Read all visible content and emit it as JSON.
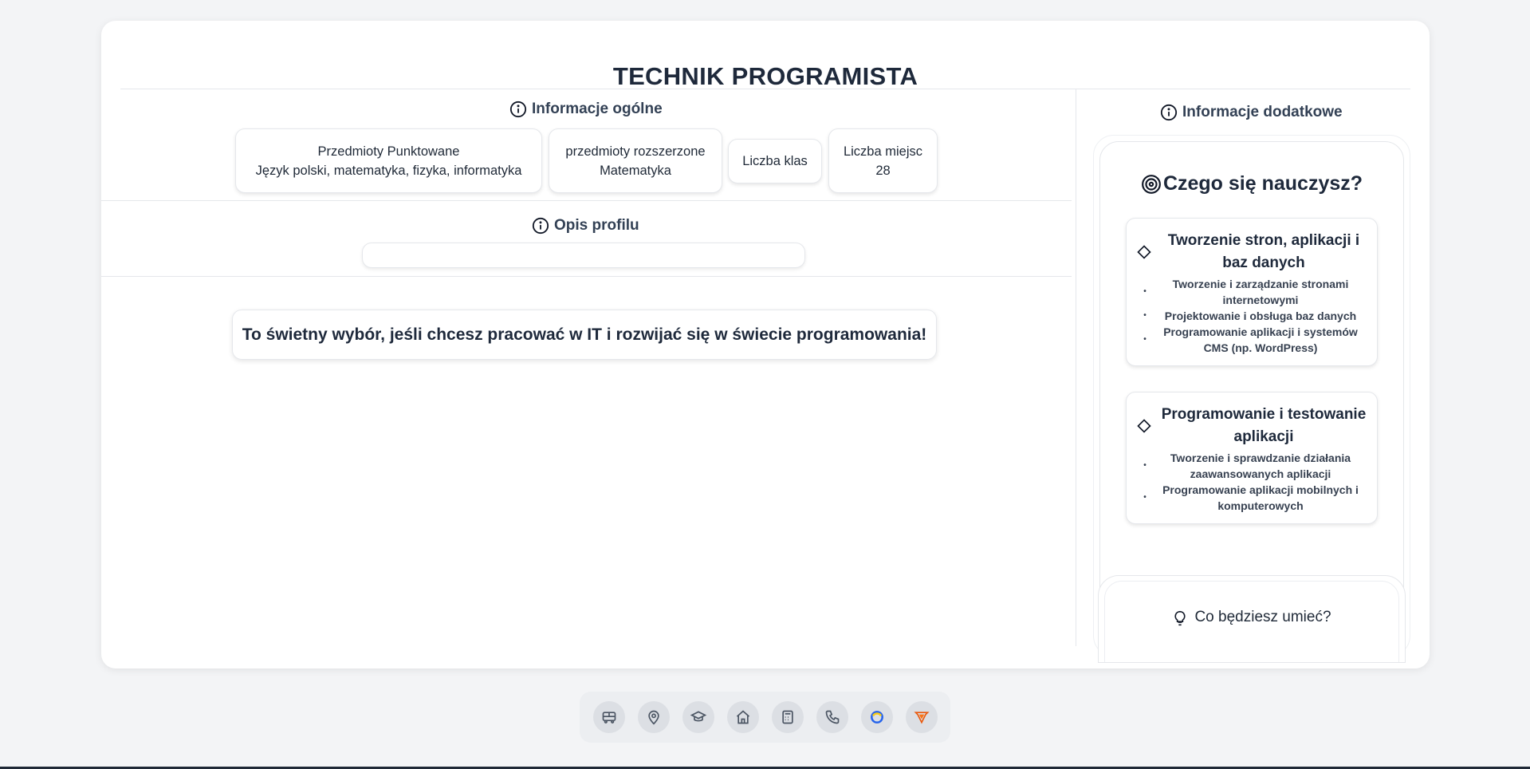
{
  "page": {
    "title": "TECHNIK PROGRAMISTA"
  },
  "general": {
    "heading": "Informacje ogólne",
    "pills": [
      {
        "label": "Przedmioty Punktowane",
        "value": "Język polski, matematyka, fizyka, informatyka"
      },
      {
        "label": "przedmioty rozszerzone",
        "value": "Matematyka"
      },
      {
        "label": "Liczba klas",
        "value": ""
      },
      {
        "label": "Liczba miejsc",
        "value": "28"
      }
    ]
  },
  "profile": {
    "heading": "Opis profilu",
    "description": ""
  },
  "cta": {
    "text": "To świetny wybór, jeśli chcesz pracować w IT i rozwijać się w świecie programowania!"
  },
  "side": {
    "heading": "Informacje dodatkowe",
    "learn_heading": "Czego się nauczysz?",
    "topics": [
      {
        "title": "Tworzenie stron, aplikacji i baz danych",
        "items": [
          "Tworzenie i zarządzanie stronami internetowymi",
          "Projektowanie i obsługa baz danych",
          "Programowanie aplikacji i systemów CMS (np. WordPress)"
        ]
      },
      {
        "title": "Programowanie i testowanie aplikacji",
        "items": [
          "Tworzenie i sprawdzanie działania zaawansowanych aplikacji",
          "Programowanie aplikacji mobilnych i komputerowych"
        ]
      }
    ],
    "next_heading": "Co będziesz umieć?"
  },
  "dock": {
    "icons": [
      "bus-icon",
      "map-pin-icon",
      "graduation-cap-icon",
      "home-icon",
      "calculator-icon",
      "phone-icon",
      "circle-logo-icon",
      "shield-logo-icon"
    ]
  },
  "colors": {
    "background": "#f3f4f6",
    "card": "#ffffff",
    "text": "#1e293b",
    "border": "#e5e7eb"
  }
}
